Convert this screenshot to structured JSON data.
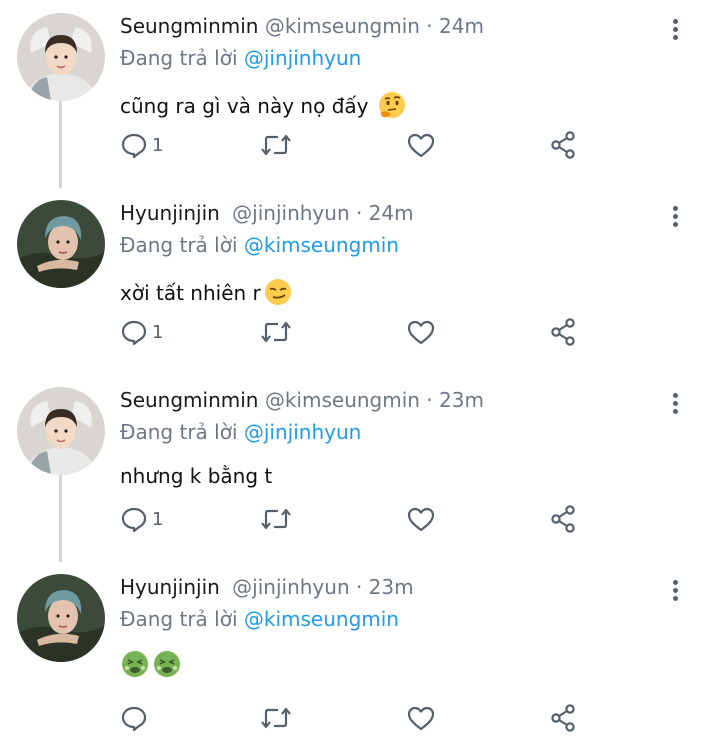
{
  "tweets": [
    {
      "display_name": "Seungminmin",
      "meta": "@kimseungmin · 24m",
      "replying_prefix": "Đang trả lời",
      "replying_handle": "@jinjinhyun",
      "text": "cũng ra gì và này nọ đấy",
      "emoji": "thinking-face",
      "reply_count": "1",
      "avatar": "seungmin"
    },
    {
      "display_name": "Hyunjinjin",
      "meta": "@jinjinhyun · 24m",
      "replying_prefix": "Đang trả lời",
      "replying_handle": "@kimseungmin",
      "text": "xời tất nhiên r",
      "emoji": "smirking-face",
      "reply_count": "1",
      "avatar": "hyunjin"
    },
    {
      "display_name": "Seungminmin",
      "meta": "@kimseungmin · 23m",
      "replying_prefix": "Đang trả lời",
      "replying_handle": "@jinjinhyun",
      "text": "nhưng k bằng t",
      "emoji": "",
      "reply_count": "1",
      "avatar": "seungmin"
    },
    {
      "display_name": "Hyunjinjin",
      "meta": "@jinjinhyun · 23m",
      "replying_prefix": "Đang trả lời",
      "replying_handle": "@kimseungmin",
      "text": "",
      "emoji": "nauseated-face-x2",
      "reply_count": "",
      "avatar": "hyunjin"
    }
  ],
  "colors": {
    "accent": "#1d9bf0",
    "muted": "#6d7884",
    "icon": "#56606a",
    "thread_line": "#cfd5da"
  }
}
